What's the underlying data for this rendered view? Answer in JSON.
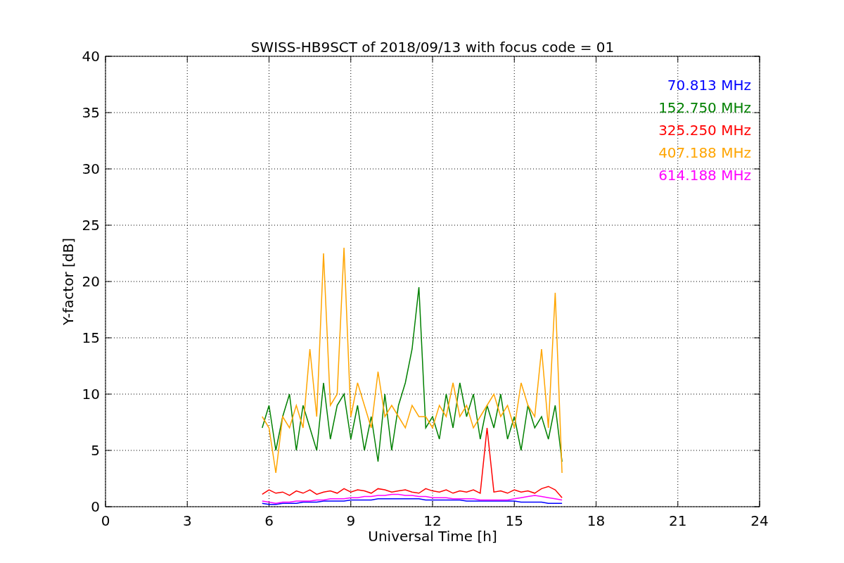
{
  "figure": {
    "chart_data": {
      "type": "line",
      "title": "SWISS-HB9SCT of 2018/09/13 with focus code = 01",
      "xlabel": "Universal Time [h]",
      "ylabel": "Y-factor [dB]",
      "x": [
        5.75,
        6,
        6.25,
        6.5,
        6.75,
        7,
        7.25,
        7.5,
        7.75,
        8,
        8.25,
        8.5,
        8.75,
        9,
        9.25,
        9.5,
        9.75,
        10,
        10.25,
        10.5,
        10.75,
        11,
        11.25,
        11.5,
        11.75,
        12,
        12.25,
        12.5,
        12.75,
        13,
        13.25,
        13.5,
        13.75,
        14,
        14.25,
        14.5,
        14.75,
        15,
        15.25,
        15.5,
        15.75,
        16,
        16.25,
        16.5,
        16.75
      ],
      "series": [
        {
          "name": "70.813 MHz",
          "color": "#0000ff",
          "values": [
            0.3,
            0.2,
            0.2,
            0.3,
            0.3,
            0.3,
            0.4,
            0.4,
            0.4,
            0.5,
            0.5,
            0.5,
            0.5,
            0.6,
            0.6,
            0.6,
            0.6,
            0.7,
            0.7,
            0.7,
            0.7,
            0.7,
            0.7,
            0.7,
            0.6,
            0.6,
            0.6,
            0.6,
            0.6,
            0.6,
            0.5,
            0.5,
            0.5,
            0.5,
            0.5,
            0.5,
            0.5,
            0.5,
            0.4,
            0.4,
            0.4,
            0.4,
            0.3,
            0.3,
            0.3
          ]
        },
        {
          "name": "152.750 MHz",
          "color": "#008000",
          "values": [
            7,
            9,
            5,
            8,
            10,
            5,
            9,
            7,
            5,
            11,
            6,
            9,
            10,
            6,
            9,
            5,
            8,
            4,
            10,
            5,
            9,
            11,
            14,
            19.5,
            7,
            8,
            6,
            10,
            7,
            11,
            8,
            10,
            6,
            9,
            7,
            10,
            6,
            8,
            5,
            9,
            7,
            8,
            6,
            9,
            4
          ]
        },
        {
          "name": "325.250 MHz",
          "color": "#ff0000",
          "values": [
            1.1,
            1.5,
            1.2,
            1.3,
            1.0,
            1.4,
            1.2,
            1.5,
            1.1,
            1.3,
            1.4,
            1.2,
            1.6,
            1.3,
            1.5,
            1.4,
            1.2,
            1.6,
            1.5,
            1.3,
            1.4,
            1.5,
            1.3,
            1.2,
            1.6,
            1.4,
            1.3,
            1.5,
            1.2,
            1.4,
            1.3,
            1.5,
            1.2,
            7.0,
            1.3,
            1.4,
            1.2,
            1.5,
            1.3,
            1.4,
            1.2,
            1.6,
            1.8,
            1.5,
            0.8
          ]
        },
        {
          "name": "407.188 MHz",
          "color": "#ffa500",
          "values": [
            8,
            7,
            3,
            8,
            7,
            9,
            7,
            14,
            8,
            22.5,
            9,
            10,
            23,
            8,
            11,
            9,
            7,
            12,
            8,
            9,
            8,
            7,
            9,
            8,
            8,
            7,
            9,
            8,
            11,
            8,
            9,
            7,
            8,
            9,
            10,
            8,
            9,
            7,
            11,
            9,
            8,
            14,
            7,
            19,
            3
          ]
        },
        {
          "name": "614.188 MHz",
          "color": "#ff00ff",
          "values": [
            0.5,
            0.4,
            0.3,
            0.4,
            0.4,
            0.5,
            0.5,
            0.5,
            0.6,
            0.6,
            0.7,
            0.7,
            0.7,
            0.8,
            0.8,
            0.9,
            0.9,
            1.0,
            1.0,
            1.1,
            1.1,
            1.0,
            1.0,
            0.9,
            0.9,
            0.8,
            0.8,
            0.8,
            0.7,
            0.7,
            0.7,
            0.7,
            0.6,
            0.6,
            0.6,
            0.6,
            0.6,
            0.7,
            0.8,
            0.9,
            1.0,
            0.9,
            0.8,
            0.7,
            0.6
          ]
        }
      ],
      "xlim": [
        0,
        24
      ],
      "ylim": [
        0,
        40
      ],
      "xticks": [
        0,
        3,
        6,
        9,
        12,
        15,
        18,
        21,
        24
      ],
      "yticks": [
        0,
        5,
        10,
        15,
        20,
        25,
        30,
        35,
        40
      ],
      "grid": true
    }
  }
}
